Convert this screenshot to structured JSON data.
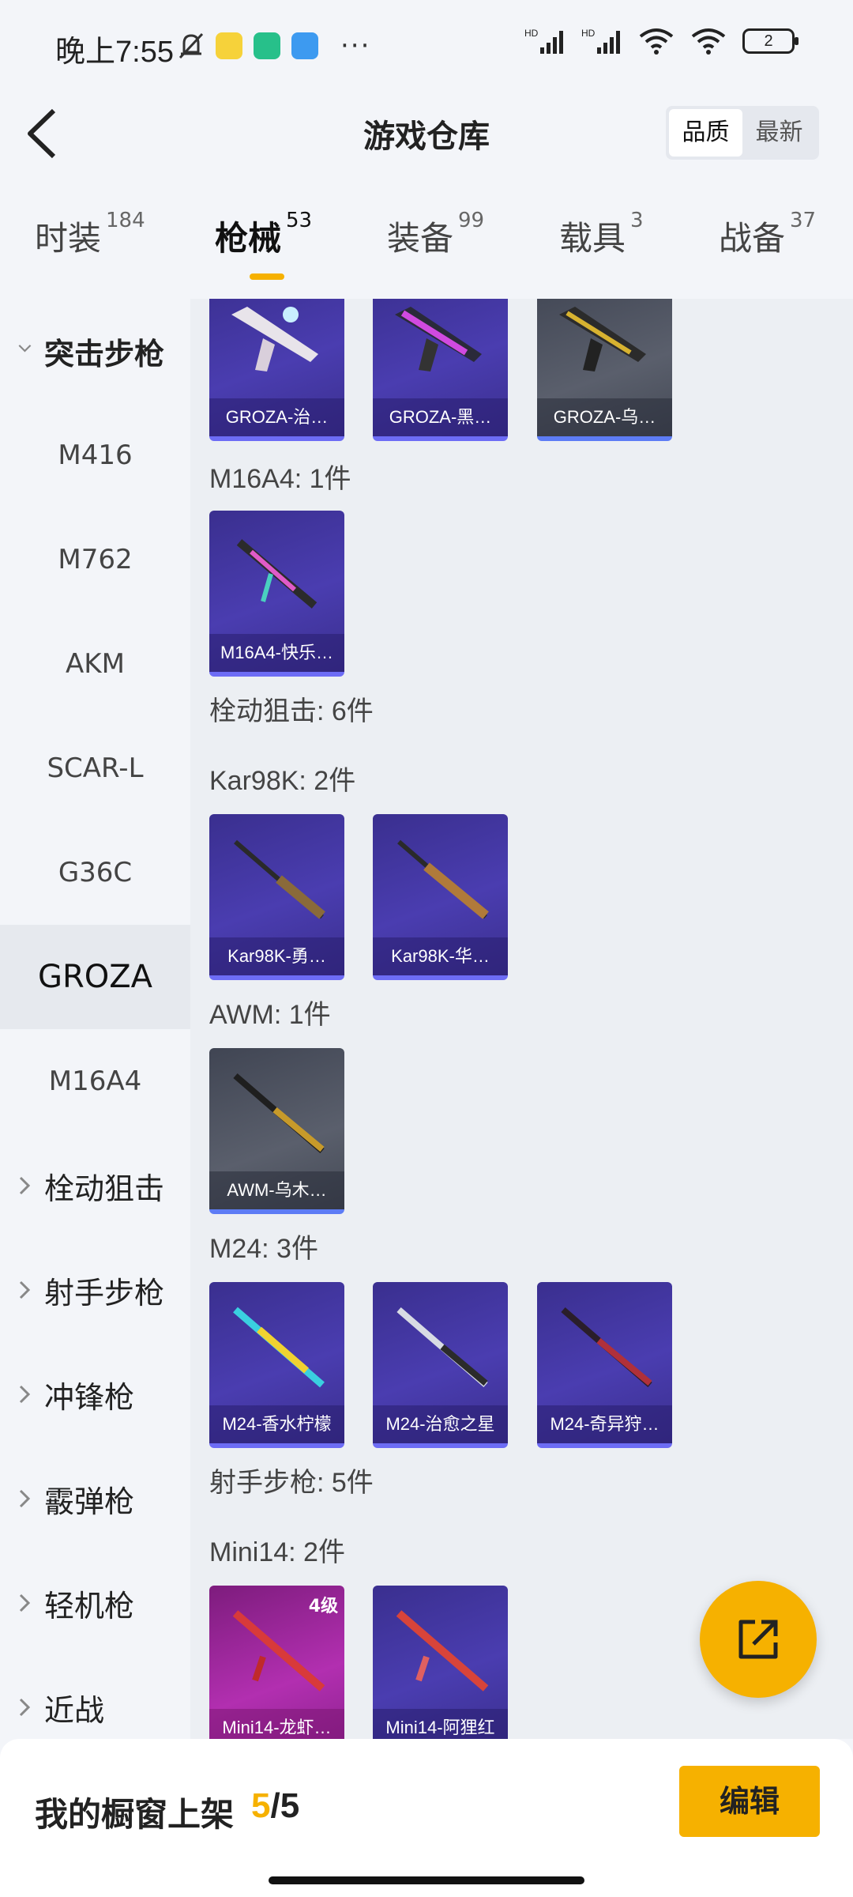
{
  "status": {
    "time": "晚上7:55",
    "signal1": "HD",
    "signal2": "HD",
    "battery": "2",
    "dots": "···"
  },
  "header": {
    "title": "游戏仓库",
    "sort_options": [
      "品质",
      "最新"
    ]
  },
  "tabs": [
    {
      "label": "时装",
      "count": "184"
    },
    {
      "label": "枪械",
      "count": "53"
    },
    {
      "label": "装备",
      "count": "99"
    },
    {
      "label": "载具",
      "count": "3"
    },
    {
      "label": "战备",
      "count": "37"
    }
  ],
  "sidebar": {
    "groups": [
      {
        "label": "突击步枪"
      },
      {
        "label": "栓动狙击"
      },
      {
        "label": "射手步枪"
      },
      {
        "label": "冲锋枪"
      },
      {
        "label": "霰弹枪"
      },
      {
        "label": "轻机枪"
      },
      {
        "label": "近战"
      }
    ],
    "sub_items": [
      "M416",
      "M762",
      "AKM",
      "SCAR-L",
      "G36C",
      "GROZA",
      "M16A4"
    ]
  },
  "content": {
    "sections": [
      "M16A4: 1件",
      "栓动狙击: 6件",
      "Kar98K: 2件",
      "AWM: 1件",
      "M24: 3件",
      "射手步枪: 5件",
      "Mini14: 2件"
    ],
    "cards": [
      {
        "name": "GROZA-治…"
      },
      {
        "name": "GROZA-黑…"
      },
      {
        "name": "GROZA-乌…"
      },
      {
        "name": "M16A4-快乐…"
      },
      {
        "name": "Kar98K-勇…"
      },
      {
        "name": "Kar98K-华…"
      },
      {
        "name": "AWM-乌木…"
      },
      {
        "name": "M24-香水柠檬"
      },
      {
        "name": "M24-治愈之星"
      },
      {
        "name": "M24-奇异狩…"
      },
      {
        "name": "Mini14-龙虾…",
        "level": "4级"
      },
      {
        "name": "Mini14-阿狸红"
      }
    ]
  },
  "bottom": {
    "showcase_label": "我的橱窗上架",
    "current": "5",
    "total": "/5",
    "edit_label": "编辑"
  },
  "colors": {
    "accent": "#f6b100",
    "card_purple": "#4a3db0",
    "card_grey": "#5a5f6c",
    "card_pink": "#b22fb0"
  }
}
